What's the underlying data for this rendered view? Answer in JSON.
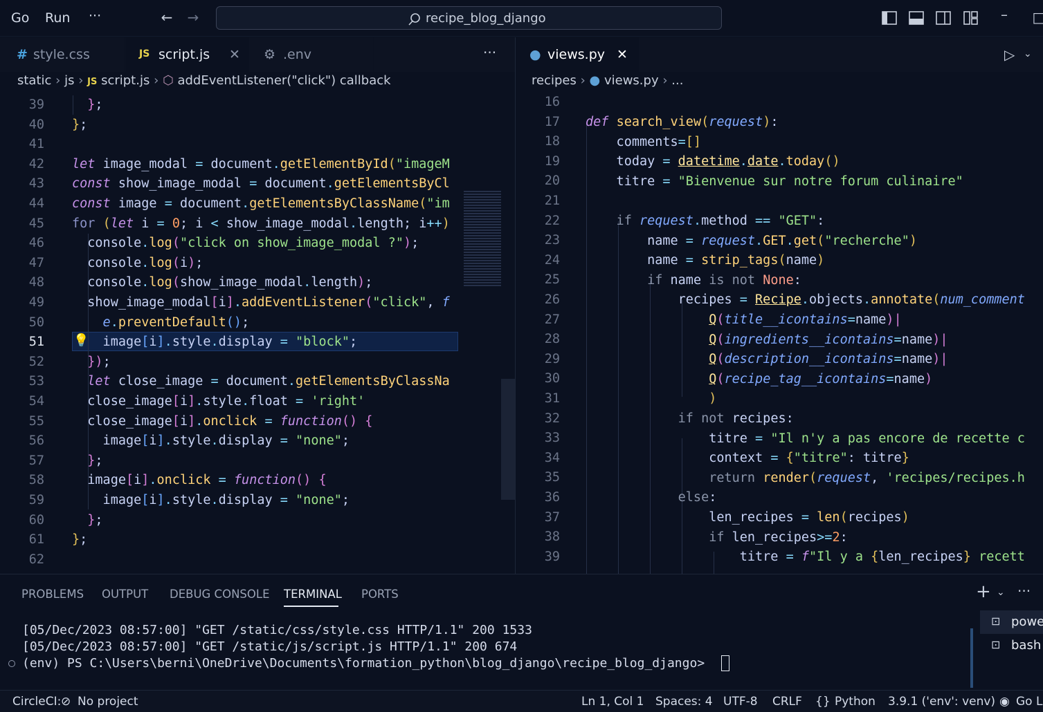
{
  "menu": {
    "go": "Go",
    "run": "Run",
    "more": "···"
  },
  "search": {
    "text": "recipe_blog_django"
  },
  "left_tabs": [
    {
      "icon": "#",
      "label": "style.css"
    },
    {
      "icon": "JS",
      "label": "script.js"
    },
    {
      "icon": "⚙",
      "label": ".env"
    }
  ],
  "right_tabs": [
    {
      "label": "views.py"
    }
  ],
  "left_breadcrumb": {
    "p1": "static",
    "p2": "js",
    "p3": "script.js",
    "p4": "addEventListener(\"click\") callback",
    "js": "JS"
  },
  "right_breadcrumb": {
    "p1": "recipes",
    "p2": "views.py",
    "p3": "..."
  },
  "left_line_numbers": [
    "39",
    "40",
    "41",
    "42",
    "43",
    "44",
    "45",
    "46",
    "47",
    "48",
    "49",
    "50",
    "51",
    "52",
    "53",
    "54",
    "55",
    "56",
    "57",
    "58",
    "59",
    "60",
    "61",
    "62"
  ],
  "right_line_numbers": [
    "16",
    "17",
    "18",
    "19",
    "20",
    "21",
    "22",
    "23",
    "24",
    "25",
    "26",
    "27",
    "28",
    "29",
    "30",
    "31",
    "32",
    "33",
    "34",
    "35",
    "36",
    "37",
    "38",
    "39"
  ],
  "panel": {
    "tabs": [
      "PROBLEMS",
      "OUTPUT",
      "DEBUG CONSOLE",
      "TERMINAL",
      "PORTS"
    ],
    "terminal_lines": [
      "[05/Dec/2023 08:57:00] \"GET /static/css/style.css HTTP/1.1\" 200 1533",
      "[05/Dec/2023 08:57:00] \"GET /static/js/script.js HTTP/1.1\" 200 674",
      "(env) PS C:\\Users\\berni\\OneDrive\\Documents\\formation_python\\blog_django\\recipe_blog_django> "
    ],
    "shells": [
      "powe",
      "bash"
    ]
  },
  "status": {
    "circleci": "CircleCI:",
    "project": "No project",
    "position": "Ln 1, Col 1",
    "spaces": "Spaces: 4",
    "encoding": "UTF-8",
    "eol": "CRLF",
    "language": "Python",
    "interpreter": "3.9.1 ('env': venv)",
    "golive": "Go Li"
  }
}
